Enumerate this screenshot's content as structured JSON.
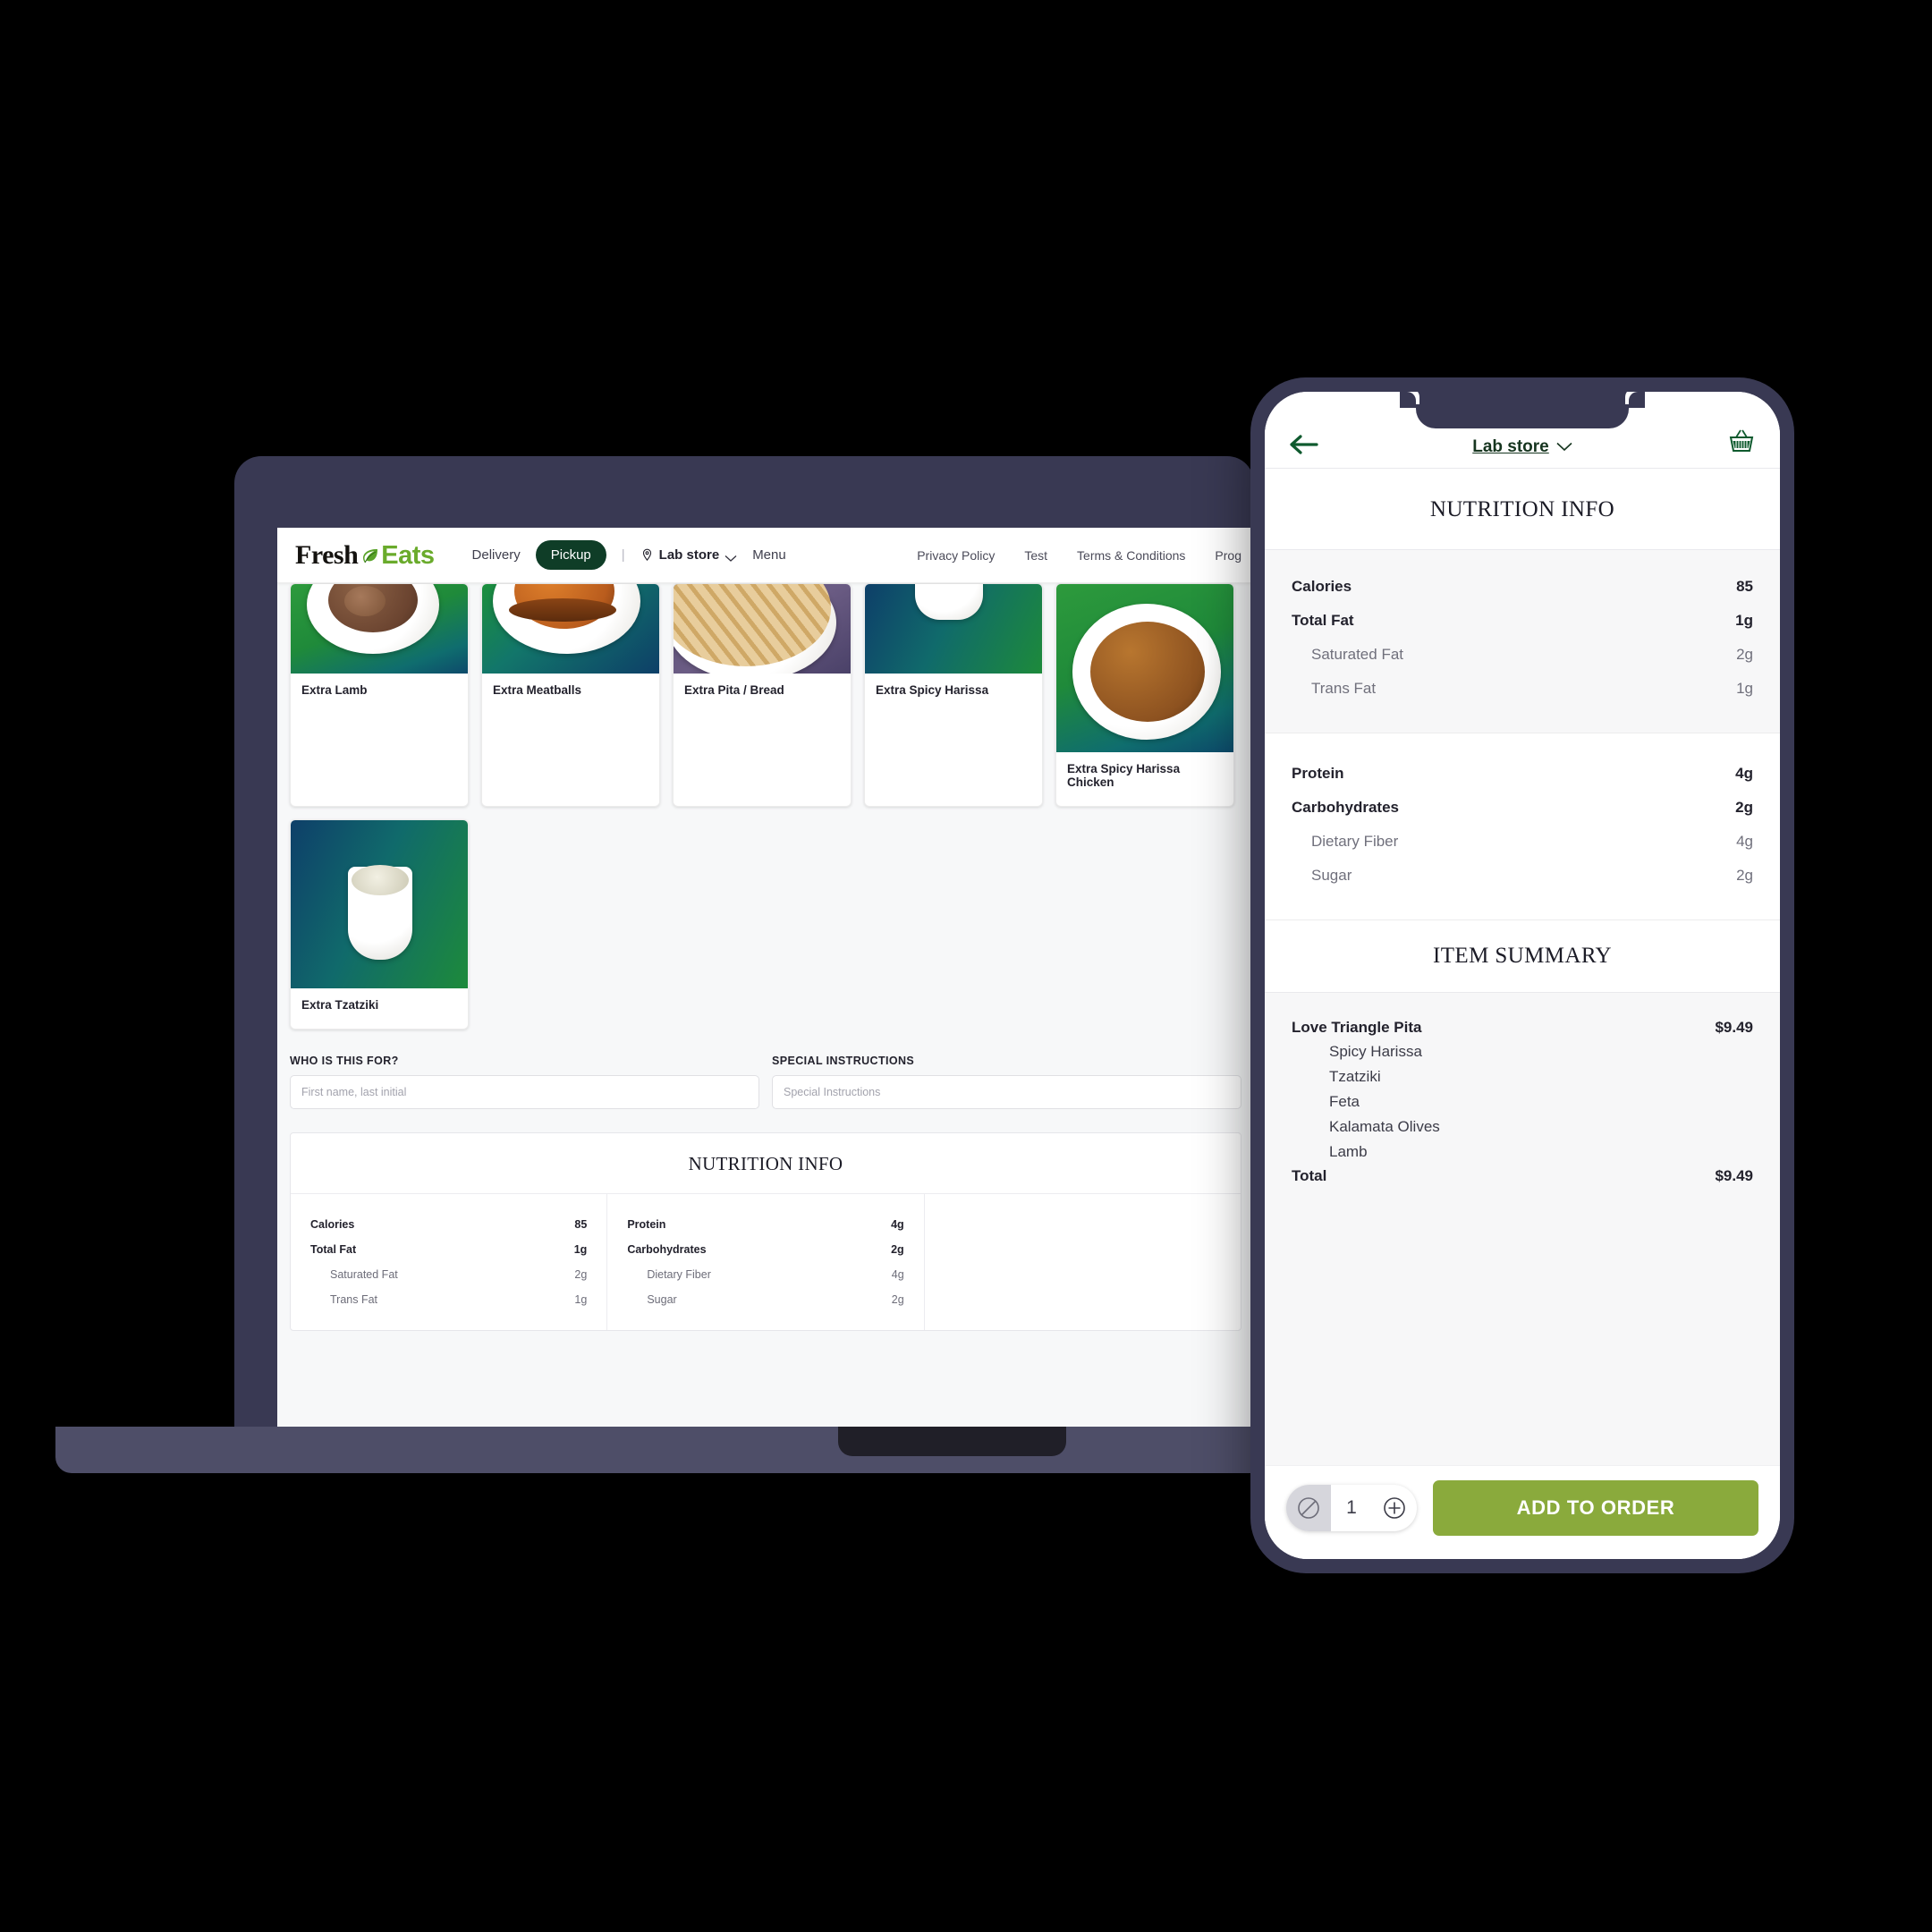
{
  "desktop": {
    "logo": {
      "part1": "Fresh",
      "part2": "Eats",
      "leaf_icon": "leaf-icon"
    },
    "nav": {
      "delivery_label": "Delivery",
      "pickup_label": "Pickup",
      "separator": "|",
      "store_label": "Lab store",
      "pin_icon": "location-pin-icon",
      "chevron_icon": "chevron-down-icon",
      "menu_label": "Menu"
    },
    "nav_right": [
      "Privacy Policy",
      "Test",
      "Terms & Conditions",
      "Prog"
    ],
    "cards": [
      {
        "label": "Extra Lamb",
        "style": "wood-g",
        "row": 1
      },
      {
        "label": "Extra Meatballs",
        "style": "wood-b",
        "row": 1
      },
      {
        "label": "Extra Pita / Bread",
        "style": "wood-p",
        "row": 1
      },
      {
        "label": "Extra Spicy Harissa",
        "style": "wood-gb",
        "row": 1
      },
      {
        "label": "Extra Spicy Harissa Chicken",
        "style": "wood-g",
        "row": 2
      },
      {
        "label": "Extra Tzatziki",
        "style": "wood-gb",
        "row": 2
      }
    ],
    "form": {
      "who_label": "WHO IS THIS FOR?",
      "who_placeholder": "First name, last initial",
      "special_label": "SPECIAL INSTRUCTIONS",
      "special_placeholder": "Special Instructions"
    },
    "nutrition": {
      "title": "NUTRITION INFO",
      "left": [
        {
          "label": "Calories",
          "value": "85",
          "sub": false
        },
        {
          "label": "Total Fat",
          "value": "1g",
          "sub": false
        },
        {
          "label": "Saturated Fat",
          "value": "2g",
          "sub": true
        },
        {
          "label": "Trans Fat",
          "value": "1g",
          "sub": true
        }
      ],
      "right": [
        {
          "label": "Protein",
          "value": "4g",
          "sub": false
        },
        {
          "label": "Carbohydrates",
          "value": "2g",
          "sub": false
        },
        {
          "label": "Dietary Fiber",
          "value": "4g",
          "sub": true
        },
        {
          "label": "Sugar",
          "value": "2g",
          "sub": true
        }
      ]
    }
  },
  "phone": {
    "header": {
      "back_icon": "back-arrow-icon",
      "store_label": "Lab store",
      "chevron_icon": "chevron-down-icon",
      "basket_icon": "shopping-basket-icon"
    },
    "nutrition_title": "NUTRITION INFO",
    "nutrition_group_a": [
      {
        "label": "Calories",
        "value": "85",
        "sub": false
      },
      {
        "label": "Total Fat",
        "value": "1g",
        "sub": false
      },
      {
        "label": "Saturated Fat",
        "value": "2g",
        "sub": true
      },
      {
        "label": "Trans Fat",
        "value": "1g",
        "sub": true
      }
    ],
    "nutrition_group_b": [
      {
        "label": "Protein",
        "value": "4g",
        "sub": false
      },
      {
        "label": "Carbohydrates",
        "value": "2g",
        "sub": false
      },
      {
        "label": "Dietary Fiber",
        "value": "4g",
        "sub": true
      },
      {
        "label": "Sugar",
        "value": "2g",
        "sub": true
      }
    ],
    "summary_title": "ITEM SUMMARY",
    "summary": {
      "item_name": "Love Triangle Pita",
      "item_price": "$9.49",
      "options": [
        "Spicy Harissa",
        "Tzatziki",
        "Feta",
        "Kalamata Olives",
        "Lamb"
      ],
      "total_label": "Total",
      "total_price": "$9.49"
    },
    "footer": {
      "minus_icon": "disabled-minus-icon",
      "quantity": "1",
      "plus_icon": "plus-circle-icon",
      "add_label": "ADD TO ORDER"
    }
  },
  "colors": {
    "frame": "#393953",
    "frame_base": "#4e4e68",
    "brand_green": "#6aab2c",
    "pickup_dark_green": "#0f3d27",
    "button_green": "#8aaa3c",
    "store_green": "#16351f"
  }
}
